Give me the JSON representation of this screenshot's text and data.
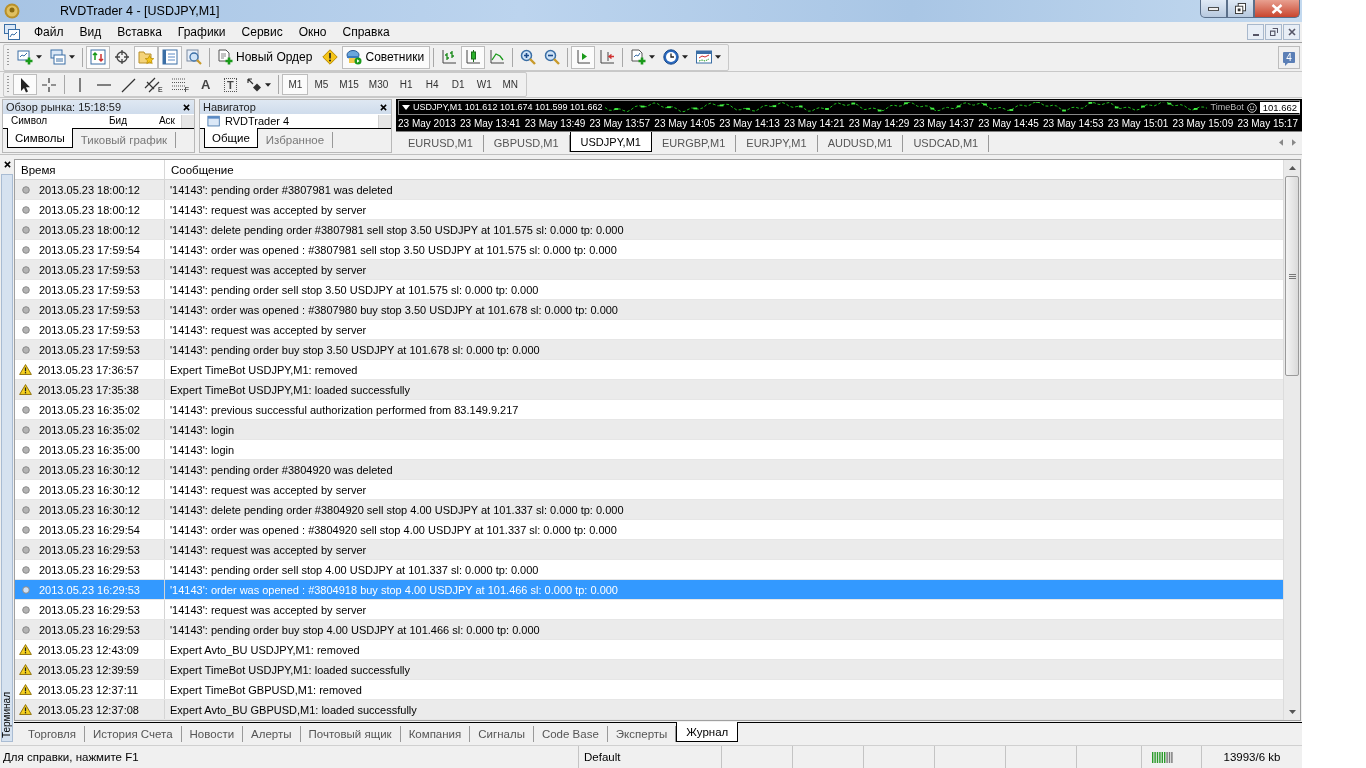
{
  "window": {
    "title": "RVDTrader 4 - [USDJPY,M1]"
  },
  "menu": [
    "Файл",
    "Вид",
    "Вставка",
    "Графики",
    "Сервис",
    "Окно",
    "Справка"
  ],
  "toolbar_1": {
    "groups": [
      [
        {
          "pressed": false
        },
        {
          "pressed": false
        }
      ],
      [
        {
          "pressed": true
        },
        {
          "pressed": false
        },
        {
          "pressed": true
        },
        {
          "pressed": true
        },
        {
          "pressed": false
        }
      ],
      [
        {
          "label": "Новый Ордер",
          "pressed": false
        },
        {
          "pressed": false
        },
        {
          "label": "Советники",
          "pressed": true
        }
      ],
      [
        {
          "pressed": false
        },
        {
          "pressed": true
        },
        {
          "pressed": false
        }
      ],
      [
        {
          "pressed": false
        },
        {
          "pressed": false
        }
      ],
      [
        {
          "pressed": true
        },
        {
          "pressed": false
        }
      ],
      [
        {
          "pressed": false
        },
        {
          "pressed": false
        },
        {
          "pressed": false
        }
      ]
    ],
    "messages_count": "4"
  },
  "toolbar_2": {
    "groups": [
      [
        {
          "pressed": true
        },
        {
          "pressed": false
        }
      ],
      [
        {
          "pressed": false
        },
        {
          "pressed": false
        },
        {
          "pressed": false
        },
        {
          "label": "E",
          "pressed": false
        },
        {
          "label": "F",
          "pressed": false
        },
        {
          "label": "A",
          "pressed": false
        },
        {
          "label": "T",
          "pressed": false
        },
        {
          "pressed": false
        }
      ]
    ],
    "timeframes": [
      {
        "label": "M1",
        "selected": true
      },
      {
        "label": "M5",
        "selected": false
      },
      {
        "label": "M15",
        "selected": false
      },
      {
        "label": "M30",
        "selected": false
      },
      {
        "label": "H1",
        "selected": false
      },
      {
        "label": "H4",
        "selected": false
      },
      {
        "label": "D1",
        "selected": false
      },
      {
        "label": "W1",
        "selected": false
      },
      {
        "label": "MN",
        "selected": false
      }
    ]
  },
  "market_watch": {
    "title": "Обзор рынка: 15:18:59",
    "columns": [
      "Символ",
      "Бид",
      "Аск"
    ],
    "tabs": [
      {
        "label": "Символы",
        "selected": true
      },
      {
        "label": "Тиковый график",
        "selected": false
      }
    ]
  },
  "navigator": {
    "title": "Навигатор",
    "items": [
      "RVDTrader 4"
    ],
    "tabs": [
      {
        "label": "Общие",
        "selected": true
      },
      {
        "label": "Избранное",
        "selected": false
      }
    ]
  },
  "chart": {
    "header": "USDJPY,M1 101.612 101.674 101.599 101.662",
    "expert": "TimeBot",
    "price_label": "101.662",
    "time_labels": [
      "23 May 2013",
      "23 May 13:41",
      "23 May 13:49",
      "23 May 13:57",
      "23 May 14:05",
      "23 May 14:13",
      "23 May 14:21",
      "23 May 14:29",
      "23 May 14:37",
      "23 May 14:45",
      "23 May 14:53",
      "23 May 15:01",
      "23 May 15:09",
      "23 May 15:17"
    ],
    "tabs": [
      {
        "label": "EURUSD,M1",
        "selected": false
      },
      {
        "label": "GBPUSD,M1",
        "selected": false
      },
      {
        "label": "USDJPY,M1",
        "selected": true
      },
      {
        "label": "EURGBP,M1",
        "selected": false
      },
      {
        "label": "EURJPY,M1",
        "selected": false
      },
      {
        "label": "AUDUSD,M1",
        "selected": false
      },
      {
        "label": "USDCAD,M1",
        "selected": false
      }
    ]
  },
  "terminal": {
    "title": "Терминал",
    "columns": [
      "Время",
      "Сообщение"
    ],
    "rows": [
      {
        "kind": "info",
        "time": "2013.05.23 18:00:12",
        "message": "'14143': pending order #3807981 was deleted",
        "selected": false
      },
      {
        "kind": "info",
        "time": "2013.05.23 18:00:12",
        "message": "'14143': request was accepted by server",
        "selected": false
      },
      {
        "kind": "info",
        "time": "2013.05.23 18:00:12",
        "message": "'14143': delete pending order #3807981 sell stop 3.50 USDJPY at 101.575 sl: 0.000 tp: 0.000",
        "selected": false
      },
      {
        "kind": "info",
        "time": "2013.05.23 17:59:54",
        "message": "'14143': order was opened : #3807981 sell stop 3.50 USDJPY at 101.575 sl: 0.000 tp: 0.000",
        "selected": false
      },
      {
        "kind": "info",
        "time": "2013.05.23 17:59:53",
        "message": "'14143': request was accepted by server",
        "selected": false
      },
      {
        "kind": "info",
        "time": "2013.05.23 17:59:53",
        "message": "'14143': pending order sell stop 3.50 USDJPY at 101.575 sl: 0.000 tp: 0.000",
        "selected": false
      },
      {
        "kind": "info",
        "time": "2013.05.23 17:59:53",
        "message": "'14143': order was opened : #3807980 buy stop 3.50 USDJPY at 101.678 sl: 0.000 tp: 0.000",
        "selected": false
      },
      {
        "kind": "info",
        "time": "2013.05.23 17:59:53",
        "message": "'14143': request was accepted by server",
        "selected": false
      },
      {
        "kind": "info",
        "time": "2013.05.23 17:59:53",
        "message": "'14143': pending order buy stop 3.50 USDJPY at 101.678 sl: 0.000 tp: 0.000",
        "selected": false
      },
      {
        "kind": "warning",
        "time": "2013.05.23 17:36:57",
        "message": "Expert TimeBot USDJPY,M1: removed",
        "selected": false
      },
      {
        "kind": "warning",
        "time": "2013.05.23 17:35:38",
        "message": "Expert TimeBot USDJPY,M1: loaded successfully",
        "selected": false
      },
      {
        "kind": "info",
        "time": "2013.05.23 16:35:02",
        "message": "'14143': previous successful authorization performed from 83.149.9.217",
        "selected": false
      },
      {
        "kind": "info",
        "time": "2013.05.23 16:35:02",
        "message": "'14143': login",
        "selected": false
      },
      {
        "kind": "info",
        "time": "2013.05.23 16:35:00",
        "message": "'14143': login",
        "selected": false
      },
      {
        "kind": "info",
        "time": "2013.05.23 16:30:12",
        "message": "'14143': pending order #3804920 was deleted",
        "selected": false
      },
      {
        "kind": "info",
        "time": "2013.05.23 16:30:12",
        "message": "'14143': request was accepted by server",
        "selected": false
      },
      {
        "kind": "info",
        "time": "2013.05.23 16:30:12",
        "message": "'14143': delete pending order #3804920 sell stop 4.00 USDJPY at 101.337 sl: 0.000 tp: 0.000",
        "selected": false
      },
      {
        "kind": "info",
        "time": "2013.05.23 16:29:54",
        "message": "'14143': order was opened : #3804920 sell stop 4.00 USDJPY at 101.337 sl: 0.000 tp: 0.000",
        "selected": false
      },
      {
        "kind": "info",
        "time": "2013.05.23 16:29:53",
        "message": "'14143': request was accepted by server",
        "selected": false
      },
      {
        "kind": "info",
        "time": "2013.05.23 16:29:53",
        "message": "'14143': pending order sell stop 4.00 USDJPY at 101.337 sl: 0.000 tp: 0.000",
        "selected": false
      },
      {
        "kind": "info",
        "time": "2013.05.23 16:29:53",
        "message": "'14143': order was opened : #3804918 buy stop 4.00 USDJPY at 101.466 sl: 0.000 tp: 0.000",
        "selected": true
      },
      {
        "kind": "info",
        "time": "2013.05.23 16:29:53",
        "message": "'14143': request was accepted by server",
        "selected": false
      },
      {
        "kind": "info",
        "time": "2013.05.23 16:29:53",
        "message": "'14143': pending order buy stop 4.00 USDJPY at 101.466 sl: 0.000 tp: 0.000",
        "selected": false
      },
      {
        "kind": "warning",
        "time": "2013.05.23 12:43:09",
        "message": "Expert Avto_BU USDJPY,M1: removed",
        "selected": false
      },
      {
        "kind": "warning",
        "time": "2013.05.23 12:39:59",
        "message": "Expert TimeBot USDJPY,M1: loaded successfully",
        "selected": false
      },
      {
        "kind": "warning",
        "time": "2013.05.23 12:37:11",
        "message": "Expert TimeBot GBPUSD,M1: removed",
        "selected": false
      },
      {
        "kind": "warning",
        "time": "2013.05.23 12:37:08",
        "message": "Expert Avto_BU GBPUSD,M1: loaded successfully",
        "selected": false
      }
    ],
    "tabs": [
      {
        "label": "Торговля",
        "selected": false
      },
      {
        "label": "История Счета",
        "selected": false
      },
      {
        "label": "Новости",
        "selected": false
      },
      {
        "label": "Алерты",
        "selected": false
      },
      {
        "label": "Почтовый ящик",
        "selected": false
      },
      {
        "label": "Компания",
        "selected": false
      },
      {
        "label": "Сигналы",
        "selected": false
      },
      {
        "label": "Code Base",
        "selected": false
      },
      {
        "label": "Эксперты",
        "selected": false
      },
      {
        "label": "Журнал",
        "selected": true
      }
    ]
  },
  "status_bar": {
    "help": "Для справки, нажмите F1",
    "profile": "Default",
    "traffic": "13993/6 kb"
  }
}
